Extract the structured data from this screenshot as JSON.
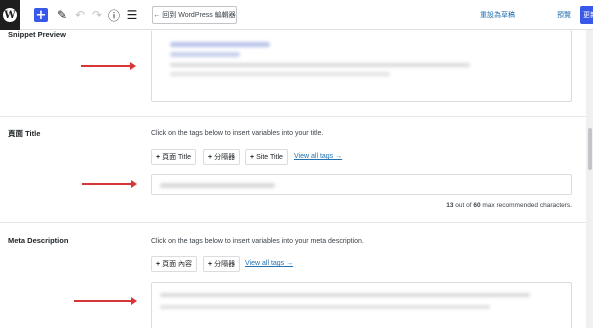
{
  "toolbar": {
    "back_label": "← 回到 WordPress 編輯器",
    "switch_draft_label": "重設為草稿",
    "preview_label": "預覽",
    "update_label": "更新"
  },
  "snippet_preview": {
    "label": "Snippet Preview"
  },
  "page_title_section": {
    "label": "頁面 Title",
    "help": "Click on the tags below to insert variables into your title.",
    "tags": [
      "頁面 Title",
      "分隔器",
      "Site Title"
    ],
    "view_all": "View all tags →",
    "counter_value": "13",
    "counter_middle": " out of ",
    "counter_max": "60",
    "counter_suffix": " max recommended characters."
  },
  "meta_description_section": {
    "label": "Meta Description",
    "help": "Click on the tags below to insert variables into your meta description.",
    "tags": [
      "頁面 內容",
      "分隔器"
    ],
    "view_all": "View all tags →"
  },
  "colors": {
    "accent": "#3858e9",
    "link": "#2271b1",
    "arrow": "#d63638"
  }
}
